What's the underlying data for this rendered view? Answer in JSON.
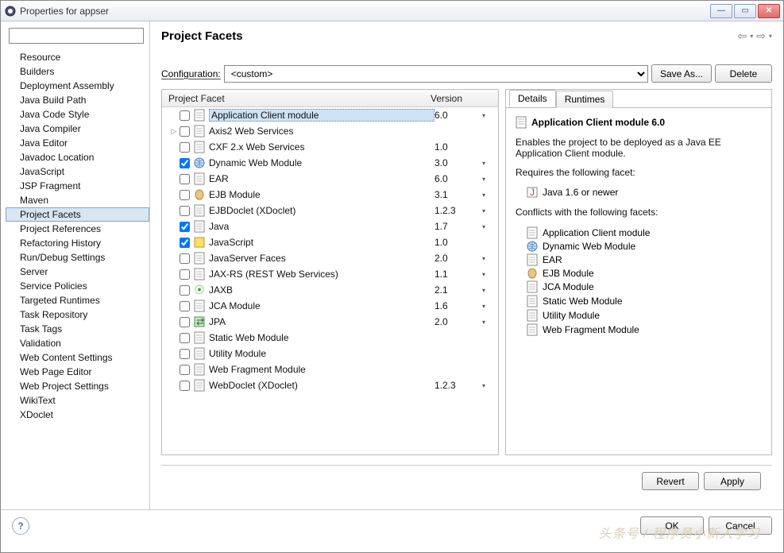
{
  "window": {
    "title": "Properties for appser"
  },
  "sidebar": {
    "filter_placeholder": "",
    "items": [
      "Resource",
      "Builders",
      "Deployment Assembly",
      "Java Build Path",
      "Java Code Style",
      "Java Compiler",
      "Java Editor",
      "Javadoc Location",
      "JavaScript",
      "JSP Fragment",
      "Maven",
      "Project Facets",
      "Project References",
      "Refactoring History",
      "Run/Debug Settings",
      "Server",
      "Service Policies",
      "Targeted Runtimes",
      "Task Repository",
      "Task Tags",
      "Validation",
      "Web Content Settings",
      "Web Page Editor",
      "Web Project Settings",
      "WikiText",
      "XDoclet"
    ],
    "selected": "Project Facets"
  },
  "header": {
    "title": "Project Facets"
  },
  "config": {
    "label": "Configuration:",
    "value": "<custom>",
    "save_as": "Save As...",
    "delete": "Delete"
  },
  "facet_table": {
    "columns": {
      "facet": "Project Facet",
      "version": "Version"
    },
    "rows": [
      {
        "checked": false,
        "name": "Application Client module",
        "version": "6.0",
        "dd": true,
        "icon": "doc",
        "expander": "",
        "selected": true
      },
      {
        "checked": false,
        "name": "Axis2 Web Services",
        "version": "",
        "dd": false,
        "icon": "doc",
        "expander": "▷"
      },
      {
        "checked": false,
        "name": "CXF 2.x Web Services",
        "version": "1.0",
        "dd": false,
        "icon": "doc",
        "expander": ""
      },
      {
        "checked": true,
        "name": "Dynamic Web Module",
        "version": "3.0",
        "dd": true,
        "icon": "globe",
        "expander": ""
      },
      {
        "checked": false,
        "name": "EAR",
        "version": "6.0",
        "dd": true,
        "icon": "doc",
        "expander": ""
      },
      {
        "checked": false,
        "name": "EJB Module",
        "version": "3.1",
        "dd": true,
        "icon": "bean",
        "expander": ""
      },
      {
        "checked": false,
        "name": "EJBDoclet (XDoclet)",
        "version": "1.2.3",
        "dd": true,
        "icon": "doc",
        "expander": ""
      },
      {
        "checked": true,
        "name": "Java",
        "version": "1.7",
        "dd": true,
        "icon": "doc",
        "expander": ""
      },
      {
        "checked": true,
        "name": "JavaScript",
        "version": "1.0",
        "dd": false,
        "icon": "js",
        "expander": ""
      },
      {
        "checked": false,
        "name": "JavaServer Faces",
        "version": "2.0",
        "dd": true,
        "icon": "doc",
        "expander": ""
      },
      {
        "checked": false,
        "name": "JAX-RS (REST Web Services)",
        "version": "1.1",
        "dd": true,
        "icon": "doc",
        "expander": ""
      },
      {
        "checked": false,
        "name": "JAXB",
        "version": "2.1",
        "dd": true,
        "icon": "jaxb",
        "expander": ""
      },
      {
        "checked": false,
        "name": "JCA Module",
        "version": "1.6",
        "dd": true,
        "icon": "doc",
        "expander": ""
      },
      {
        "checked": false,
        "name": "JPA",
        "version": "2.0",
        "dd": true,
        "icon": "jpa",
        "expander": ""
      },
      {
        "checked": false,
        "name": "Static Web Module",
        "version": "",
        "dd": false,
        "icon": "doc",
        "expander": ""
      },
      {
        "checked": false,
        "name": "Utility Module",
        "version": "",
        "dd": false,
        "icon": "doc",
        "expander": ""
      },
      {
        "checked": false,
        "name": "Web Fragment Module",
        "version": "",
        "dd": false,
        "icon": "doc",
        "expander": ""
      },
      {
        "checked": false,
        "name": "WebDoclet (XDoclet)",
        "version": "1.2.3",
        "dd": true,
        "icon": "doc",
        "expander": ""
      }
    ]
  },
  "tabs": {
    "details": "Details",
    "runtimes": "Runtimes",
    "active": "details"
  },
  "details": {
    "title": "Application Client module 6.0",
    "description": "Enables the project to be deployed as a Java EE Application Client module.",
    "requires_label": "Requires the following facet:",
    "requires": [
      {
        "icon": "java",
        "label": "Java 1.6 or newer"
      }
    ],
    "conflicts_label": "Conflicts with the following facets:",
    "conflicts": [
      {
        "icon": "doc",
        "label": "Application Client module"
      },
      {
        "icon": "globe",
        "label": "Dynamic Web Module"
      },
      {
        "icon": "doc",
        "label": "EAR"
      },
      {
        "icon": "bean",
        "label": "EJB Module"
      },
      {
        "icon": "doc",
        "label": "JCA Module"
      },
      {
        "icon": "doc",
        "label": "Static Web Module"
      },
      {
        "icon": "doc",
        "label": "Utility Module"
      },
      {
        "icon": "doc",
        "label": "Web Fragment Module"
      }
    ]
  },
  "footer": {
    "revert": "Revert",
    "apply": "Apply"
  },
  "bottom": {
    "ok": "OK",
    "cancel": "Cancel"
  },
  "watermark": "头条号 / 程序员小新入学习"
}
